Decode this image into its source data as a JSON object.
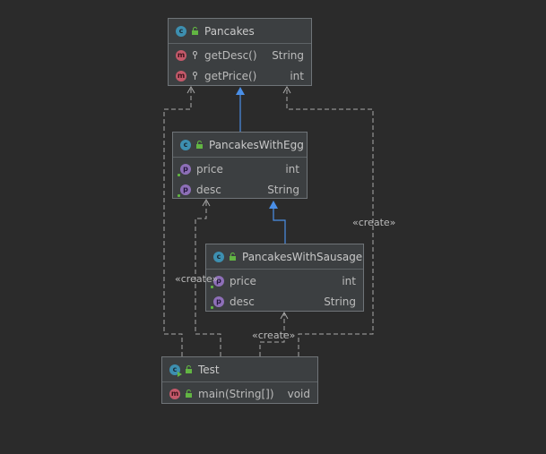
{
  "classes": {
    "pancakes": {
      "name": "Pancakes",
      "members": [
        {
          "kind": "m",
          "name": "getDesc()",
          "type": "String"
        },
        {
          "kind": "m",
          "name": "getPrice()",
          "type": "int"
        }
      ]
    },
    "egg": {
      "name": "PancakesWithEgg",
      "members": [
        {
          "kind": "p",
          "name": "price",
          "type": "int"
        },
        {
          "kind": "p",
          "name": "desc",
          "type": "String"
        }
      ]
    },
    "sausage": {
      "name": "PancakesWithSausage",
      "members": [
        {
          "kind": "p",
          "name": "price",
          "type": "int"
        },
        {
          "kind": "p",
          "name": "desc",
          "type": "String"
        }
      ]
    },
    "test": {
      "name": "Test",
      "members": [
        {
          "kind": "m",
          "name": "main(String[])",
          "type": "void"
        }
      ]
    }
  },
  "labels": {
    "create_right": "«create»",
    "create_left": "«create»",
    "create_bottom": "«create»"
  },
  "badge_letters": {
    "class": "c",
    "method": "m",
    "property": "p"
  },
  "colors": {
    "background": "#2b2b2b",
    "node_fill": "#3c3f41",
    "node_border": "#6f7478",
    "inheritance": "#4a8fe7",
    "dependency": "#a9a9a9"
  }
}
